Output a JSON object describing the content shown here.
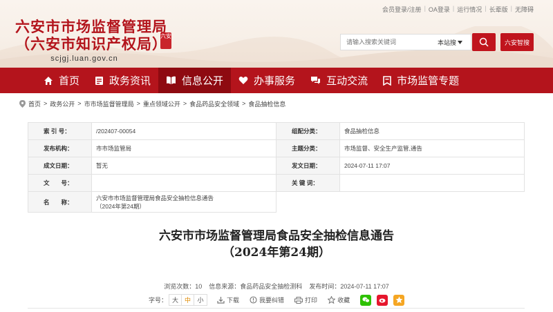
{
  "header": {
    "top_links": [
      "会员登录/注册",
      "OA登录",
      "运行情况",
      "长辈版",
      "无障碍"
    ],
    "title_line1": "六安市市场监督管理局",
    "title_line2": "（六安市知识产权局）",
    "domain": "scjgj.luan.gov.cn",
    "seal_text": "六安",
    "search_placeholder": "请输入搜索关键词",
    "search_scope": "本站搜",
    "smart_search": "六安智搜"
  },
  "nav": {
    "items": [
      {
        "label": "首页",
        "icon": "home-icon"
      },
      {
        "label": "政务资讯",
        "icon": "document-icon"
      },
      {
        "label": "信息公开",
        "icon": "book-icon"
      },
      {
        "label": "办事服务",
        "icon": "heart-icon"
      },
      {
        "label": "互动交流",
        "icon": "chat-icon"
      },
      {
        "label": "市场监管专题",
        "icon": "bookmark-icon"
      }
    ],
    "active_index": 2
  },
  "breadcrumb": [
    "首页",
    "政务公开",
    "市市场监督管理局",
    "重点领域公开",
    "食品药品安全领域",
    "食品抽检信息"
  ],
  "meta": {
    "index_label": "索 引 号：",
    "index_value": "/202407-00054",
    "category_label": "组配分类：",
    "category_value": "食品抽检信息",
    "publisher_label": "发布机构：",
    "publisher_value": "市市场监管局",
    "topic_label": "主题分类：",
    "topic_value": "市场监督、安全生产监管,通告",
    "created_label": "成文日期：",
    "created_value": "暂无",
    "published_label": "发文日期：",
    "published_value": "2024-07-11 17:07",
    "docno_label": "文　　号：",
    "docno_value": "",
    "keywords_label": "关 键 词：",
    "keywords_value": "",
    "name_label": "名　　称：",
    "name_value_line1": "六安市市场监督管理局食品安全抽检信息通告",
    "name_value_line2": "（2024年第24期）"
  },
  "article": {
    "title_line1": "六安市市场监督管理局食品安全抽检信息通告",
    "title_line2": "（2024年第24期）",
    "views": "浏览次数：10",
    "source": "信息来源：食品药品安全抽检测科",
    "time": "发布时间：2024-07-11 17:07",
    "font_size_label": "字号：",
    "font_sizes": [
      "大",
      "中",
      "小"
    ],
    "download": "下载",
    "report_error": "我要纠错",
    "print": "打印",
    "favorite": "收藏"
  },
  "colors": {
    "brand_red": "#b4141c",
    "nav_active": "#8e0a11",
    "wechat": "#2dc100",
    "weibo": "#e6162d",
    "qzone": "#f5a623"
  }
}
